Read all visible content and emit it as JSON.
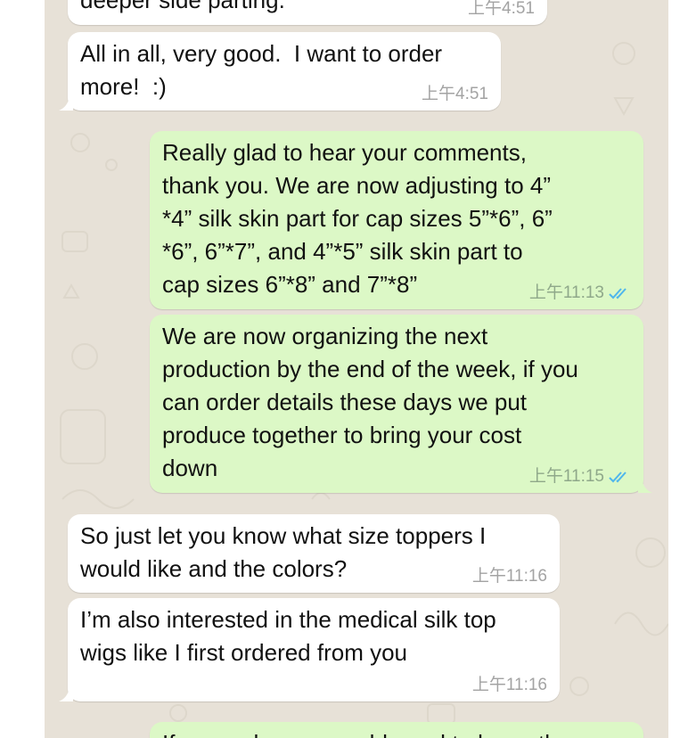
{
  "messages": [
    {
      "direction": "in",
      "text": "deeper side parting.",
      "time": "上午4:51"
    },
    {
      "direction": "in",
      "text": "All in all, very good.  I want to order\nmore!  :)",
      "time": "上午4:51"
    },
    {
      "direction": "out",
      "text": "Really glad to hear your comments,\nthank you. We are now adjusting to 4”\n*4” silk skin part for cap sizes 5”*6”, 6”\n*6”, 6”*7”, and 4”*5” silk skin part to\ncap sizes 6”*8” and 7”*8”",
      "time": "上午11:13",
      "status": "read"
    },
    {
      "direction": "out",
      "text": "We are now organizing the next\nproduction by the end of the week, if you\ncan order details these days we put\nproduce together to bring your cost\ndown",
      "time": "上午11:15",
      "status": "read"
    },
    {
      "direction": "in",
      "text": "So just let you know what size toppers I\nwould like and the colors?",
      "time": "上午11:16"
    },
    {
      "direction": "in",
      "text": "I’m also interested in the medical silk top\nwigs like I first ordered from you",
      "time": "上午11:16"
    },
    {
      "direction": "out",
      "text": "If you order, we would need to know the",
      "time": ""
    }
  ],
  "colors": {
    "wallpaper": "#e7e1d7",
    "incoming_bubble": "#ffffff",
    "outgoing_bubble": "#dcf8c6",
    "read_ticks": "#4fb6ec"
  },
  "icons": {
    "read_status": "double-check-icon"
  }
}
